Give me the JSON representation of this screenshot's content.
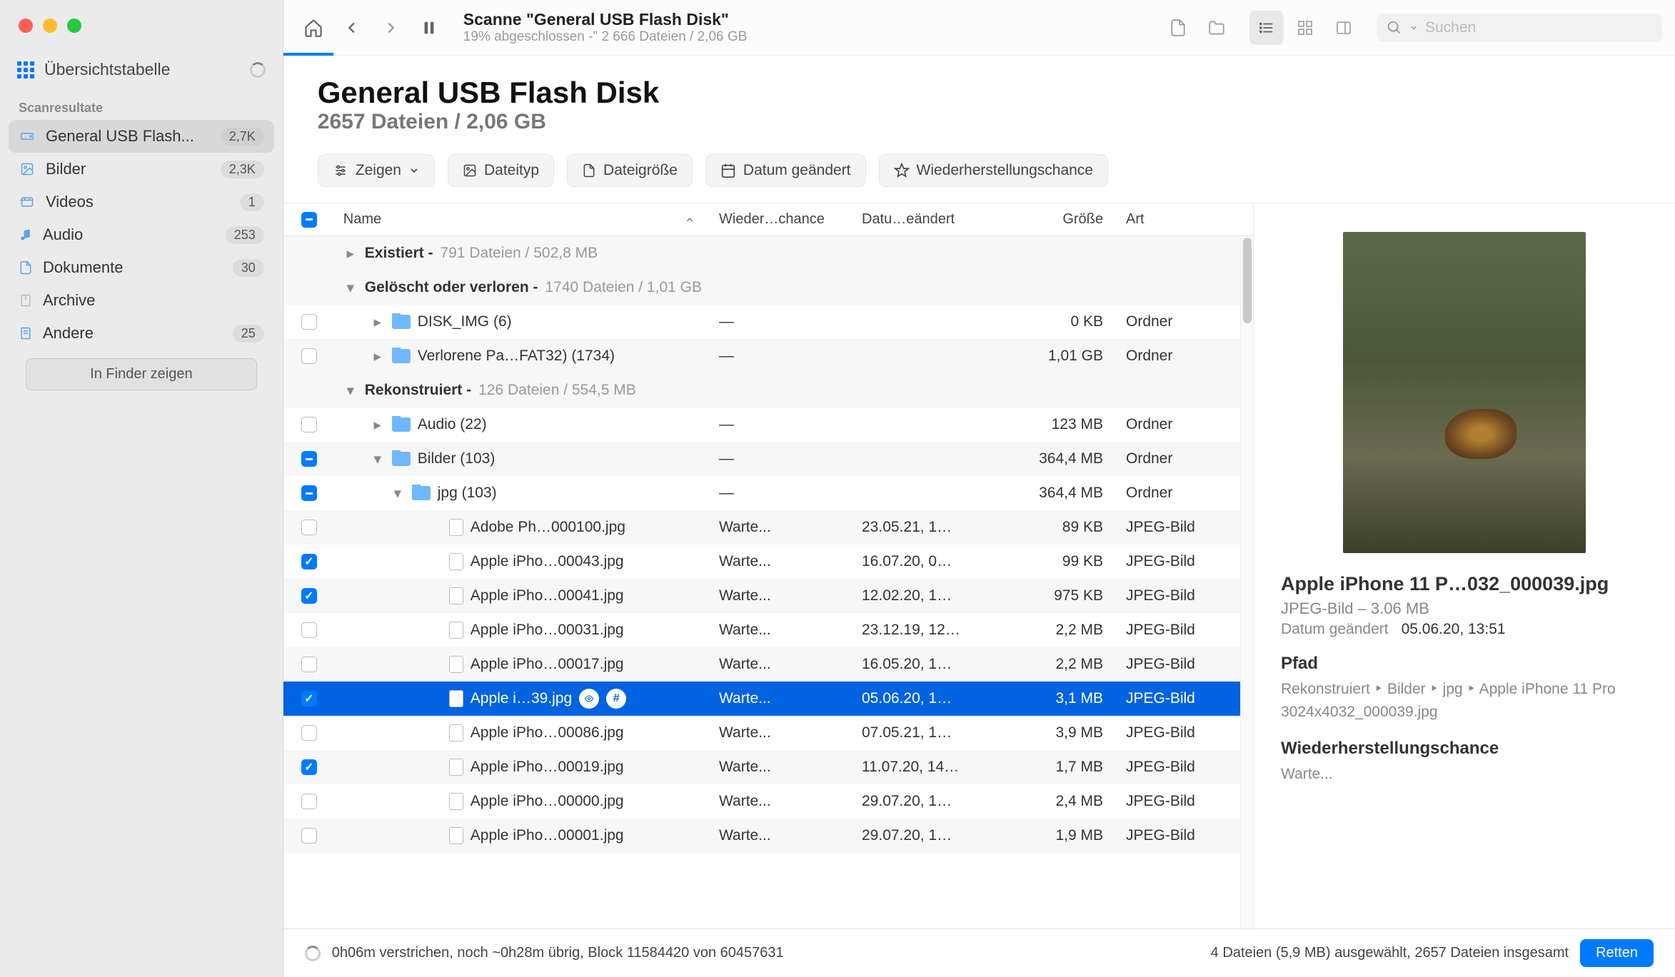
{
  "sidebar": {
    "overview_label": "Übersichtstabelle",
    "section_label": "Scanresultate",
    "items": [
      {
        "label": "General USB Flash...",
        "badge": "2,7K",
        "icon": "drive-icon",
        "active": true
      },
      {
        "label": "Bilder",
        "badge": "2,3K",
        "icon": "image-icon"
      },
      {
        "label": "Videos",
        "badge": "1",
        "icon": "video-icon"
      },
      {
        "label": "Audio",
        "badge": "253",
        "icon": "audio-icon"
      },
      {
        "label": "Dokumente",
        "badge": "30",
        "icon": "document-icon"
      },
      {
        "label": "Archive",
        "badge": "",
        "icon": "archive-icon"
      },
      {
        "label": "Andere",
        "badge": "25",
        "icon": "other-icon"
      }
    ],
    "finder_button": "In Finder zeigen"
  },
  "toolbar": {
    "title": "Scanne \"General USB Flash Disk\"",
    "subtitle": "19% abgeschlossen -\" 2 666 Dateien / 2,06 GB",
    "progress_percent": 19,
    "search_placeholder": "Suchen"
  },
  "header": {
    "title": "General USB Flash Disk",
    "subtitle": "2657 Dateien / 2,06 GB"
  },
  "filters": {
    "show": "Zeigen",
    "filetype": "Dateityp",
    "filesize": "Dateigröße",
    "date": "Datum geändert",
    "chance": "Wiederherstellungschance"
  },
  "columns": {
    "name": "Name",
    "chance": "Wieder…chance",
    "date": "Datu…eändert",
    "size": "Größe",
    "kind": "Art"
  },
  "groups": {
    "exists": {
      "label": "Existiert -",
      "meta": "791 Dateien / 502,8 MB"
    },
    "deleted": {
      "label": "Gelöscht oder verloren -",
      "meta": "1740 Dateien / 1,01 GB"
    },
    "recon": {
      "label": "Rekonstruiert -",
      "meta": "126 Dateien / 554,5 MB"
    }
  },
  "rows": [
    {
      "indent": 1,
      "disc": "right",
      "folder": true,
      "name": "DISK_IMG (6)",
      "chance": "—",
      "date": "",
      "size": "0 KB",
      "kind": "Ordner",
      "check": "empty"
    },
    {
      "indent": 1,
      "disc": "right",
      "folder": true,
      "name": "Verlorene Pa…FAT32) (1734)",
      "chance": "—",
      "date": "",
      "size": "1,01 GB",
      "kind": "Ordner",
      "check": "empty",
      "alt": true
    },
    {
      "indent": 1,
      "disc": "right",
      "folder": true,
      "name": "Audio (22)",
      "chance": "—",
      "date": "",
      "size": "123 MB",
      "kind": "Ordner",
      "check": "empty"
    },
    {
      "indent": 1,
      "disc": "down",
      "folder": true,
      "name": "Bilder (103)",
      "chance": "—",
      "date": "",
      "size": "364,4 MB",
      "kind": "Ordner",
      "check": "ind",
      "alt": true
    },
    {
      "indent": 2,
      "disc": "down",
      "folder": true,
      "name": "jpg (103)",
      "chance": "—",
      "date": "",
      "size": "364,4 MB",
      "kind": "Ordner",
      "check": "ind"
    },
    {
      "indent": 3,
      "file": true,
      "name": "Adobe Ph…000100.jpg",
      "chance": "Warte...",
      "date": "23.05.21, 1…",
      "size": "89 KB",
      "kind": "JPEG-Bild",
      "check": "empty",
      "alt": true
    },
    {
      "indent": 3,
      "file": true,
      "name": "Apple iPho…00043.jpg",
      "chance": "Warte...",
      "date": "16.07.20, 0…",
      "size": "99 KB",
      "kind": "JPEG-Bild",
      "check": "ck"
    },
    {
      "indent": 3,
      "file": true,
      "name": "Apple iPho…00041.jpg",
      "chance": "Warte...",
      "date": "12.02.20, 1…",
      "size": "975 KB",
      "kind": "JPEG-Bild",
      "check": "ck",
      "alt": true
    },
    {
      "indent": 3,
      "file": true,
      "name": "Apple iPho…00031.jpg",
      "chance": "Warte...",
      "date": "23.12.19, 12…",
      "size": "2,2 MB",
      "kind": "JPEG-Bild",
      "check": "empty"
    },
    {
      "indent": 3,
      "file": true,
      "name": "Apple iPho…00017.jpg",
      "chance": "Warte...",
      "date": "16.05.20, 1…",
      "size": "2,2 MB",
      "kind": "JPEG-Bild",
      "check": "empty",
      "alt": true
    },
    {
      "indent": 3,
      "file": true,
      "name": "Apple i…39.jpg",
      "chance": "Warte...",
      "date": "05.06.20, 1…",
      "size": "3,1 MB",
      "kind": "JPEG-Bild",
      "check": "ck",
      "selected": true,
      "badges": true
    },
    {
      "indent": 3,
      "file": true,
      "name": "Apple iPho…00086.jpg",
      "chance": "Warte...",
      "date": "07.05.21, 1…",
      "size": "3,9 MB",
      "kind": "JPEG-Bild",
      "check": "empty"
    },
    {
      "indent": 3,
      "file": true,
      "name": "Apple iPho…00019.jpg",
      "chance": "Warte...",
      "date": "11.07.20, 14…",
      "size": "1,7 MB",
      "kind": "JPEG-Bild",
      "check": "ck",
      "alt": true
    },
    {
      "indent": 3,
      "file": true,
      "name": "Apple iPho…00000.jpg",
      "chance": "Warte...",
      "date": "29.07.20, 1…",
      "size": "2,4 MB",
      "kind": "JPEG-Bild",
      "check": "empty"
    },
    {
      "indent": 3,
      "file": true,
      "name": "Apple iPho…00001.jpg",
      "chance": "Warte...",
      "date": "29.07.20, 1…",
      "size": "1,9 MB",
      "kind": "JPEG-Bild",
      "check": "empty",
      "alt": true
    }
  ],
  "preview": {
    "title": "Apple iPhone 11 P…032_000039.jpg",
    "meta": "JPEG-Bild – 3.06 MB",
    "date_label": "Datum geändert",
    "date_value": "05.06.20, 13:51",
    "path_label": "Pfad",
    "path_value": "Rekonstruiert ‣ Bilder ‣ jpg ‣ Apple iPhone 11 Pro 3024x4032_000039.jpg",
    "chance_label": "Wiederherstellungschance",
    "chance_value": "Warte..."
  },
  "status": {
    "elapsed": "0h06m verstrichen, noch ~0h28m übrig, Block 11584420 von 60457631",
    "selection": "4 Dateien (5,9 MB) ausgewählt, 2657 Dateien insgesamt",
    "save": "Retten"
  },
  "colors": {
    "accent": "#007aff",
    "select": "#0063e1"
  }
}
